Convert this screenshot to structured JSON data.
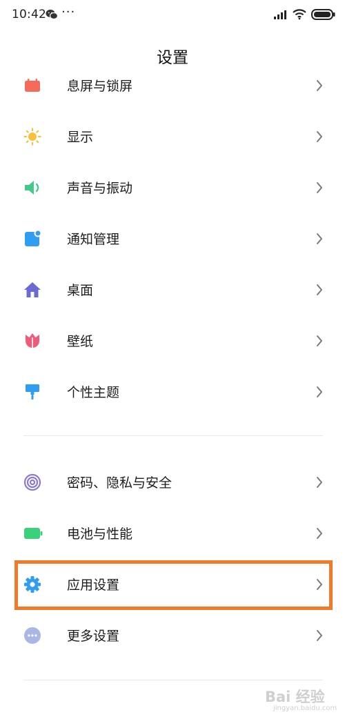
{
  "status_bar": {
    "time": "10:42",
    "more_indicator": "···"
  },
  "page_title": "设置",
  "colors": {
    "highlight": "#f07a2a",
    "lockscreen": "#f46b5a",
    "display": "#f7c23b",
    "sound": "#43c98a",
    "notification": "#2f9df1",
    "home": "#6a6ad4",
    "wallpaper": "#ee5c7a",
    "theme": "#2f9df1",
    "privacy": "#8878d8",
    "battery": "#39d17a",
    "apps": "#2f9df1",
    "more": "#a9b6e6"
  },
  "settings": {
    "lockscreen": {
      "label": "息屏与锁屏",
      "icon": "lockscreen-icon"
    },
    "display": {
      "label": "显示",
      "icon": "sun-icon"
    },
    "sound": {
      "label": "声音与振动",
      "icon": "speaker-icon"
    },
    "notifications": {
      "label": "通知管理",
      "icon": "notification-icon"
    },
    "home_screen": {
      "label": "桌面",
      "icon": "home-icon"
    },
    "wallpaper": {
      "label": "壁纸",
      "icon": "tulip-icon"
    },
    "themes": {
      "label": "个性主题",
      "icon": "paint-roller-icon"
    },
    "privacy": {
      "label": "密码、隐私与安全",
      "icon": "fingerprint-icon"
    },
    "battery": {
      "label": "电池与性能",
      "icon": "battery-icon"
    },
    "apps": {
      "label": "应用设置",
      "icon": "gear-icon"
    },
    "more": {
      "label": "更多设置",
      "icon": "more-icon"
    }
  },
  "watermark": {
    "logo": "Bai 经验",
    "sub": "jingyan.baidu.com"
  }
}
